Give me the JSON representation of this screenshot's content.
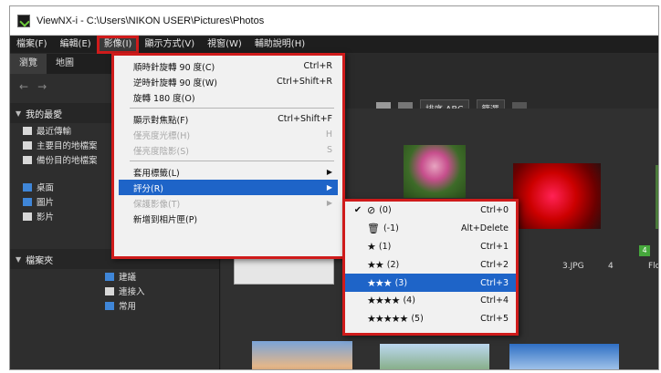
{
  "window": {
    "title": "ViewNX-i - C:\\Users\\NIKON USER\\Pictures\\Photos"
  },
  "menubar": {
    "items": [
      {
        "label": "檔案(F)"
      },
      {
        "label": "編輯(E)"
      },
      {
        "label": "影像(I)",
        "active": true
      },
      {
        "label": "顯示方式(V)"
      },
      {
        "label": "視窗(W)"
      },
      {
        "label": "輔助說明(H)"
      }
    ]
  },
  "left_panel": {
    "tabs": [
      "瀏覽",
      "地圖"
    ],
    "favorites_header": "我的最愛",
    "favorites": [
      "最近傳輸",
      "主要目的地檔案",
      "備份目的地檔案"
    ],
    "places": [
      "桌面",
      "圖片",
      "影片"
    ],
    "folders_header": "檔案夾",
    "folders": [
      "建議",
      "連接入",
      "常用"
    ]
  },
  "toolbar": {
    "sort_label": "排序 ABC",
    "filter_label": "篩選"
  },
  "image_menu": {
    "items": [
      {
        "label": "順時針旋轉 90 度(C)",
        "shortcut": "Ctrl+R"
      },
      {
        "label": "逆時針旋轉 90 度(W)",
        "shortcut": "Ctrl+Shift+R"
      },
      {
        "label": "旋轉 180 度(O)",
        "shortcut": ""
      },
      {
        "label": "顯示對焦點(F)",
        "shortcut": "Ctrl+Shift+F"
      },
      {
        "label": "僅亮度光標(H)",
        "shortcut": "H",
        "disabled": true
      },
      {
        "label": "僅亮度陰影(S)",
        "shortcut": "S",
        "disabled": true
      },
      {
        "label": "套用標籤(L)",
        "shortcut": ""
      },
      {
        "label": "評分(R)",
        "shortcut": ""
      },
      {
        "label": "保護影像(T)",
        "shortcut": "",
        "disabled": true
      },
      {
        "label": "新增到相片匣(P)",
        "shortcut": ""
      }
    ]
  },
  "rating_menu": {
    "items": [
      {
        "label": "(0)",
        "shortcut": "Ctrl+0",
        "icon": "no-rating-icon",
        "checked": true,
        "stars": 0
      },
      {
        "label": "(-1)",
        "shortcut": "Alt+Delete",
        "icon": "reject-icon",
        "stars": 0
      },
      {
        "label": "(1)",
        "shortcut": "Ctrl+1",
        "stars": 1
      },
      {
        "label": "(2)",
        "shortcut": "Ctrl+2",
        "stars": 2
      },
      {
        "label": "(3)",
        "shortcut": "Ctrl+3",
        "stars": 3,
        "highlighted": true
      },
      {
        "label": "(4)",
        "shortcut": "Ctrl+4",
        "stars": 4
      },
      {
        "label": "(5)",
        "shortcut": "Ctrl+5",
        "stars": 5
      }
    ]
  },
  "thumbnails": {
    "captions": [
      "3.JPG",
      "4",
      "Flow"
    ],
    "badge": "4"
  },
  "colors": {
    "highlight": "#1e64c8",
    "callout_red": "#cf1b1b",
    "app_background": "#2b2b2b"
  }
}
